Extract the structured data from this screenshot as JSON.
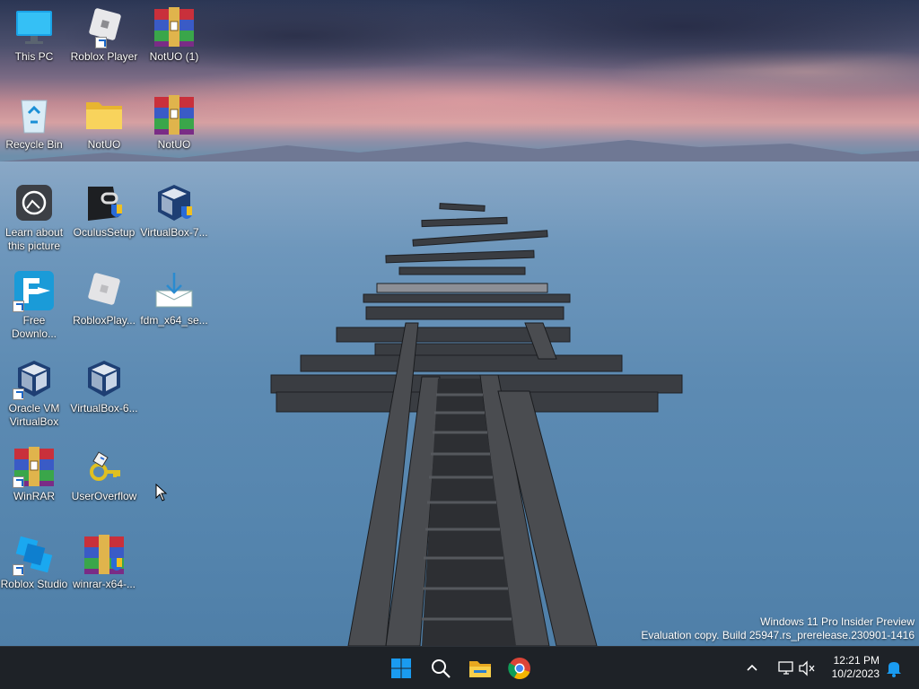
{
  "desktop_icons": [
    {
      "label": "This PC"
    },
    {
      "label": "Roblox Player"
    },
    {
      "label": "NotUO (1)"
    },
    {
      "label": "Recycle Bin"
    },
    {
      "label": "NotUO"
    },
    {
      "label": "NotUO"
    },
    {
      "label": "Learn about this picture"
    },
    {
      "label": "OculusSetup"
    },
    {
      "label": "VirtualBox-7..."
    },
    {
      "label": "Free Downlo..."
    },
    {
      "label": "RobloxPlay..."
    },
    {
      "label": "fdm_x64_se..."
    },
    {
      "label": "Oracle VM VirtualBox"
    },
    {
      "label": "VirtualBox-6..."
    },
    {
      "label": "WinRAR"
    },
    {
      "label": "UserOverflow"
    },
    {
      "label": "Roblox Studio"
    },
    {
      "label": "winrar-x64-..."
    }
  ],
  "watermark": {
    "line1": "Windows 11 Pro Insider Preview",
    "line2": "Evaluation copy. Build 25947.rs_prerelease.230901-1416"
  },
  "taskbar": {
    "pinned": [
      "start-icon",
      "search-icon",
      "file-explorer-icon",
      "chrome-icon"
    ],
    "tray": [
      "chevron-up-icon",
      "network-icon",
      "volume-muted-icon",
      "notification-bell-icon"
    ],
    "time": "12:21 PM",
    "date": "10/2/2023"
  },
  "colors": {
    "taskbar": "#1e2227",
    "windows_blue": "#1a9bf0"
  }
}
